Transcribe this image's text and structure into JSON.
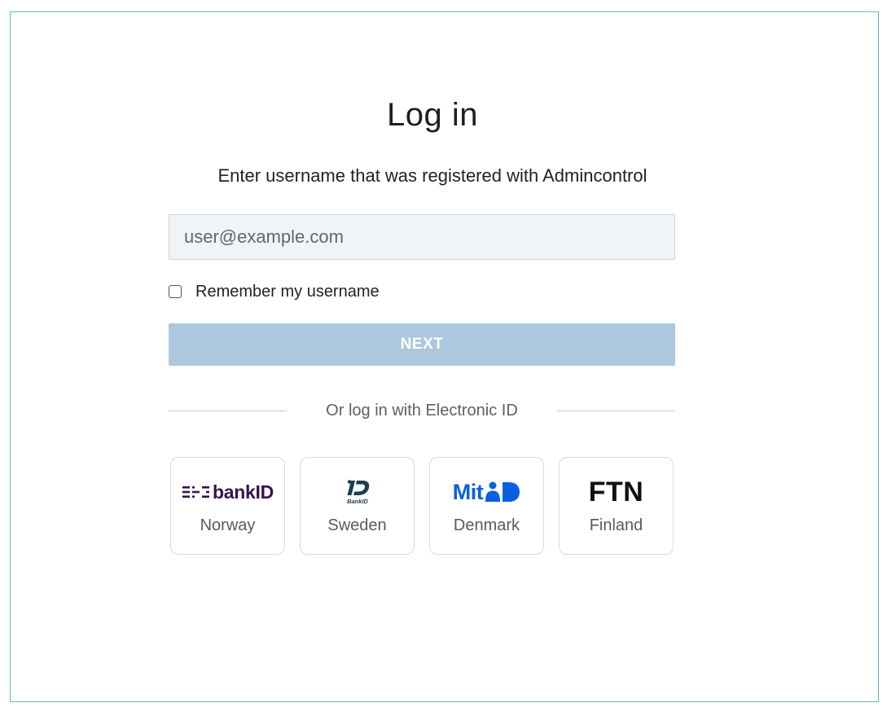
{
  "login": {
    "title": "Log in",
    "subtitle": "Enter username that was registered with Admincontrol",
    "username_placeholder": "user@example.com",
    "username_value": "",
    "remember_label": "Remember my username",
    "remember_checked": false,
    "next_label": "NEXT",
    "next_enabled": false,
    "divider_text": "Or log in with Electronic ID"
  },
  "eid_providers": [
    {
      "logo_text": "bankID",
      "logo_icon": "bankid-norway-logo",
      "label": "Norway",
      "color": "#39134c"
    },
    {
      "logo_text": "BankID",
      "logo_icon": "bankid-sweden-logo",
      "label": "Sweden",
      "color": "#193e4f"
    },
    {
      "logo_text": "Mit",
      "logo_icon": "mitid-logo",
      "label": "Denmark",
      "color": "#0a5fe0"
    },
    {
      "logo_text": "FTN",
      "logo_icon": "ftn-logo",
      "label": "Finland",
      "color": "#111111"
    }
  ],
  "colors": {
    "frame_border": "#5fc2b6",
    "input_bg": "#f1f4f7",
    "button_disabled": "#adc7dd"
  }
}
